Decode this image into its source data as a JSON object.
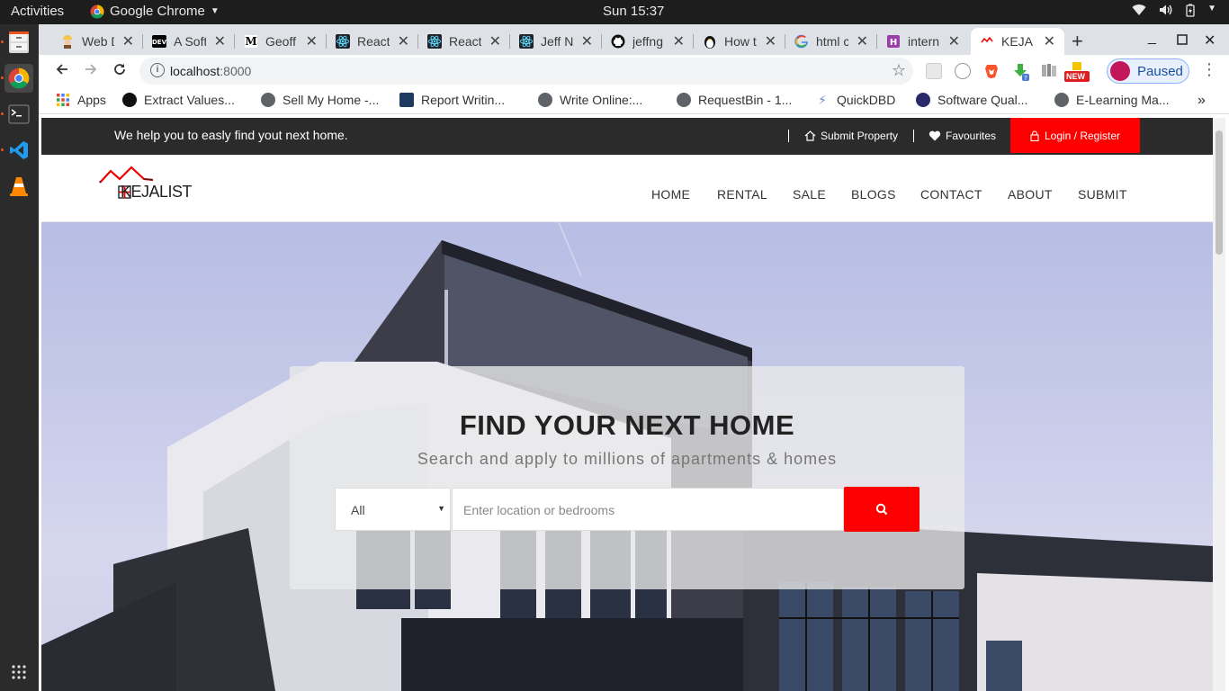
{
  "system": {
    "activities": "Activities",
    "app_name": "Google Chrome",
    "clock": "Sun 15:37"
  },
  "tabs": [
    {
      "label": "Web D",
      "icon": "construction-worker-icon"
    },
    {
      "label": "A Soft",
      "icon": "dev-icon"
    },
    {
      "label": "Geoff",
      "icon": "medium-icon"
    },
    {
      "label": "React",
      "icon": "react-icon"
    },
    {
      "label": "React",
      "icon": "react-icon"
    },
    {
      "label": "Jeff N",
      "icon": "react-icon"
    },
    {
      "label": "jeffng",
      "icon": "github-icon"
    },
    {
      "label": "How t",
      "icon": "linux-icon"
    },
    {
      "label": "html c",
      "icon": "google-icon"
    },
    {
      "label": "intern",
      "icon": "hashnode-icon"
    },
    {
      "label": "KEJAL",
      "icon": "kejalist-icon"
    }
  ],
  "toolbar": {
    "url_host": "localhost",
    "url_port": ":8000",
    "profile_label": "Paused",
    "new_badge": "NEW"
  },
  "bookmarks": [
    {
      "label": "Apps",
      "icon": "apps-grid-icon"
    },
    {
      "label": "Extract Values...",
      "icon": "github-icon"
    },
    {
      "label": "Sell My Home -...",
      "icon": "globe-icon"
    },
    {
      "label": "Report Writin...",
      "icon": "report-icon"
    },
    {
      "label": "Write Online:...",
      "icon": "globe-icon"
    },
    {
      "label": "RequestBin - 1...",
      "icon": "globe-icon"
    },
    {
      "label": "QuickDBD",
      "icon": "lightning-icon"
    },
    {
      "label": "Software Qual...",
      "icon": "software-icon"
    },
    {
      "label": "E-Learning Ma...",
      "icon": "globe-icon"
    }
  ],
  "site": {
    "tagline": "We help you to easly find yout next home.",
    "submit_property": "Submit Property",
    "favourites": "Favourites",
    "login": "Login / Register",
    "logo_text": "KEJALIST",
    "nav": [
      "HOME",
      "RENTAL",
      "SALE",
      "BLOGS",
      "CONTACT",
      "ABOUT",
      "SUBMIT"
    ],
    "hero_title": "FIND YOUR NEXT HOME",
    "hero_subtitle": "Search and apply to millions of apartments & homes",
    "select_value": "All",
    "search_placeholder": "Enter location or bedrooms",
    "accent_color": "#ff0000"
  }
}
